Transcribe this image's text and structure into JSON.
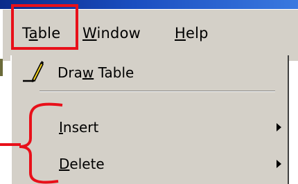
{
  "menubar": {
    "table": {
      "before": "T",
      "accel": "a",
      "after": "ble"
    },
    "window": {
      "before": "",
      "accel": "W",
      "after": "indow"
    },
    "help": {
      "before": "",
      "accel": "H",
      "after": "elp"
    }
  },
  "dropdown": {
    "draw_table": {
      "before": "Dra",
      "accel": "w",
      "after": " Table",
      "icon": "pencil-icon"
    },
    "insert": {
      "before": "",
      "accel": "I",
      "after": "nsert",
      "submenu": true
    },
    "delete": {
      "before": "",
      "accel": "D",
      "after": "elete",
      "submenu": true
    }
  },
  "annotations": {
    "highlight_color": "#e8101a"
  },
  "colors": {
    "menu_background": "#d4d0c8",
    "title_strip": "#1b4ec0"
  }
}
